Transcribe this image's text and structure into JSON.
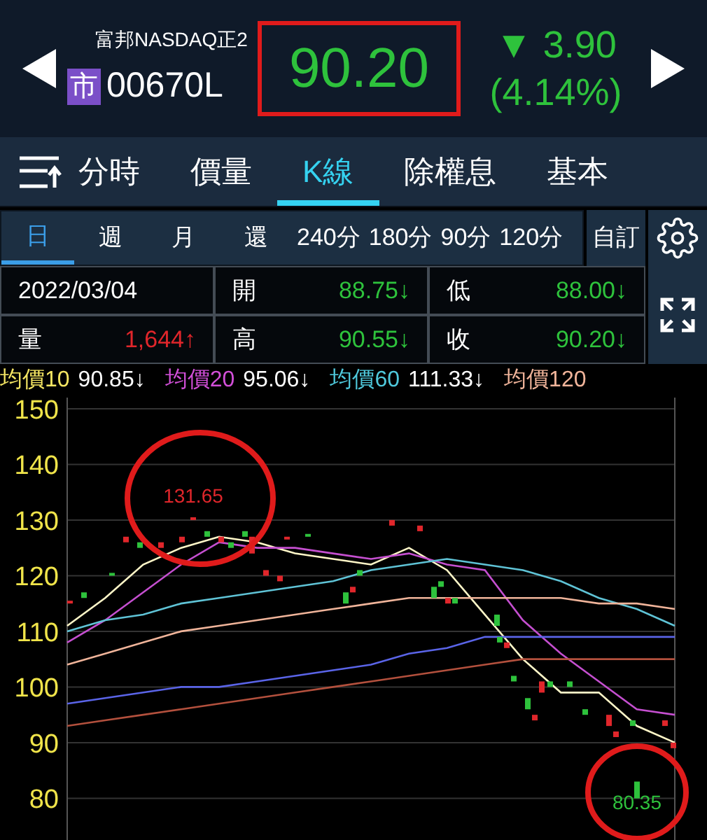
{
  "quote": {
    "name": "富邦NASDAQ正2",
    "market_badge": "市",
    "code": "00670L",
    "price": "90.20",
    "color": "#2ec23c",
    "change_sign": "▼",
    "change": "3.90",
    "change_percent": "(4.14%)"
  },
  "tabs": [
    {
      "label": "分時",
      "selected": false
    },
    {
      "label": "價量",
      "selected": false
    },
    {
      "label": "K線",
      "selected": true
    },
    {
      "label": "除權息",
      "selected": false
    },
    {
      "label": "基本",
      "selected": false
    }
  ],
  "periods": [
    {
      "label": "日",
      "selected": true
    },
    {
      "label": "週",
      "selected": false
    },
    {
      "label": "月",
      "selected": false
    },
    {
      "label": "還",
      "selected": false
    },
    {
      "label": "240分",
      "selected": false
    },
    {
      "label": "180分",
      "selected": false
    },
    {
      "label": "90分",
      "selected": false
    },
    {
      "label": "120分",
      "selected": false
    }
  ],
  "custom_button": "自訂",
  "date": "2022/03/04",
  "stats": [
    {
      "label": "開",
      "value": "88.75↓",
      "color": "#2ec23c"
    },
    {
      "label": "低",
      "value": "88.00↓",
      "color": "#2ec23c"
    },
    {
      "label": "量",
      "value": "1,644↑",
      "color": "#e0262b"
    },
    {
      "label": "高",
      "value": "90.55↓",
      "color": "#2ec23c"
    },
    {
      "label": "收",
      "value": "90.20↓",
      "color": "#2ec23c"
    }
  ],
  "averages": [
    {
      "label": "均價10",
      "value": "90.85↓",
      "color": "#f5e663"
    },
    {
      "label": "均價20",
      "value": "95.06↓",
      "color": "#d24fd8"
    },
    {
      "label": "均價60",
      "value": "111.33↓",
      "color": "#4fc9dc"
    },
    {
      "label": "均價120",
      "color": "#f0b49a"
    }
  ],
  "chart_data": {
    "type": "line",
    "ylim": [
      72.5,
      152
    ],
    "grid": true,
    "yticks": [
      150,
      140,
      130,
      120,
      110,
      100,
      90,
      80
    ],
    "series": [
      {
        "color": "#fff7c8",
        "values": [
          111,
          116,
          122,
          125,
          127,
          126,
          124,
          123,
          122,
          125,
          121,
          113,
          105,
          99,
          99,
          93,
          90
        ]
      },
      {
        "color": "#c54fd0",
        "values": [
          108,
          112,
          117,
          122,
          126,
          125,
          125,
          124,
          123,
          124,
          122,
          121,
          112,
          106,
          101,
          96,
          95
        ]
      },
      {
        "color": "#5fc3d6",
        "values": [
          110,
          112,
          113,
          115,
          116,
          117,
          118,
          119,
          121,
          122,
          123,
          122,
          121,
          119,
          116,
          114,
          111
        ]
      },
      {
        "color": "#f0b49a",
        "values": [
          104,
          106,
          108,
          110,
          111,
          112,
          113,
          114,
          115,
          116,
          116,
          116,
          116,
          116,
          115,
          115,
          114
        ]
      },
      {
        "color": "#5a64e8",
        "values": [
          97,
          98,
          99,
          100,
          100,
          101,
          102,
          103,
          104,
          106,
          107,
          109,
          109,
          109,
          109,
          109,
          109
        ]
      },
      {
        "color": "#b3503d",
        "values": [
          93,
          94,
          95,
          96,
          97,
          98,
          99,
          100,
          101,
          102,
          103,
          104,
          105,
          105,
          105,
          105,
          105
        ]
      }
    ],
    "annotations": [
      "131.65",
      "80.35"
    ]
  }
}
